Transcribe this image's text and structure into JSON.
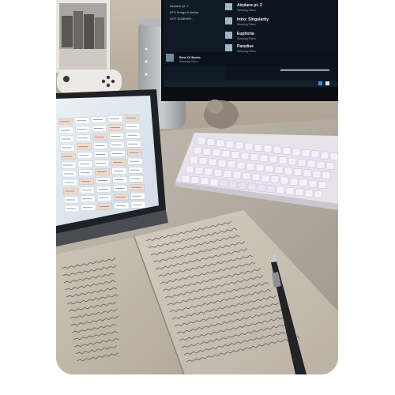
{
  "photo": {
    "subject": "desk",
    "colors": {
      "wall": "#b0a493",
      "desk": "#b9b1a6",
      "monitor_screen": "#0d1620",
      "notebook_paper": "#cdc5b8",
      "ink": "#4b4a52"
    }
  },
  "monitor": {
    "left_items": [
      "Airplane pt. 2",
      "BTS Songs & similar",
      "HOT SUMMER..."
    ],
    "playlist": [
      {
        "title": "Airplane pt. 2",
        "artist": "Sleeping Piano"
      },
      {
        "title": "Intro: Singularity",
        "artist": "Sleeping Piano"
      },
      {
        "title": "Euphoria",
        "artist": "Sleeping Piano"
      },
      {
        "title": "Paradise",
        "artist": "Sleeping Piano"
      }
    ],
    "now_playing": {
      "title": "Best Of Bomb",
      "artist": "Sleeping Piano"
    }
  }
}
